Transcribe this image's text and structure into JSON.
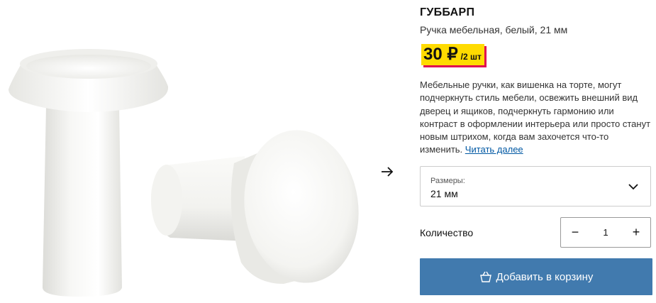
{
  "product": {
    "name": "ГУББАРП",
    "subtitle": "Ручка мебельная, белый, 21 мм",
    "price": "30 ₽",
    "price_unit": "/2 шт",
    "description": "Мебельные ручки, как вишенка на торте, могут подчеркнуть стиль мебели, освежить внешний вид дверец и ящиков, подчеркнуть гармонию или контраст в оформлении интерьера или просто станут новым штрихом, когда вам захочется что-то изменить.",
    "read_more": "Читать далее"
  },
  "size_select": {
    "label": "Размеры:",
    "value": "21 мм"
  },
  "quantity": {
    "label": "Количество",
    "value": "1",
    "minus": "−",
    "plus": "+"
  },
  "cart": {
    "add_label": "Добавить в корзину"
  },
  "colors": {
    "price_bg": "#ffdb00",
    "price_shadow": "#e00751",
    "button_bg": "#417aae",
    "link": "#0058a3"
  },
  "icons": [
    "arrow-right-icon",
    "chevron-down-icon",
    "shopping-bag-icon"
  ]
}
